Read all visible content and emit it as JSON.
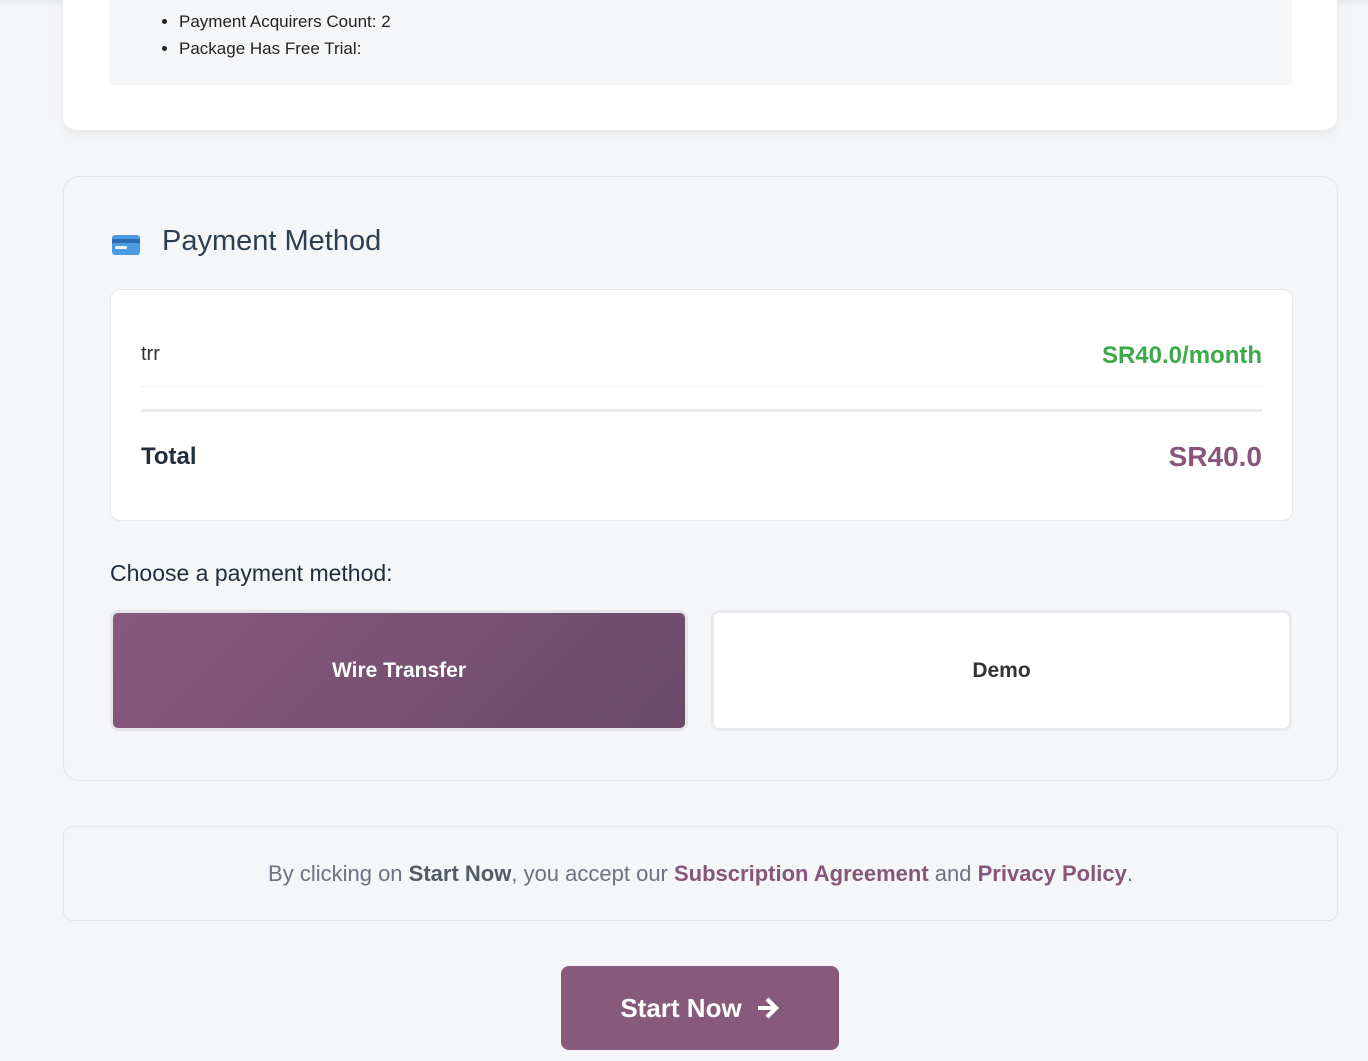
{
  "features": {
    "items": [
      "Payment Acquirers Count: 2",
      "Package Has Free Trial:"
    ]
  },
  "payment": {
    "title": "Payment Method",
    "icon": "credit-card-icon",
    "line_item": {
      "name": "trr",
      "price": "SR40.0/month"
    },
    "total_label": "Total",
    "total_value": "SR40.0",
    "choose_label": "Choose a payment method:",
    "methods": [
      {
        "label": "Wire Transfer",
        "selected": true
      },
      {
        "label": "Demo",
        "selected": false
      }
    ]
  },
  "terms": {
    "prefix": "By clicking on ",
    "start_now": "Start Now",
    "middle": ", you accept our ",
    "agreement": "Subscription Agreement",
    "and": " and ",
    "privacy": "Privacy Policy",
    "suffix": "."
  },
  "start_button": {
    "label": "Start Now",
    "icon": "arrow-right-icon"
  },
  "colors": {
    "accent": "#875a7b",
    "price_green": "#3daa4a",
    "background": "#f5f6f8"
  }
}
